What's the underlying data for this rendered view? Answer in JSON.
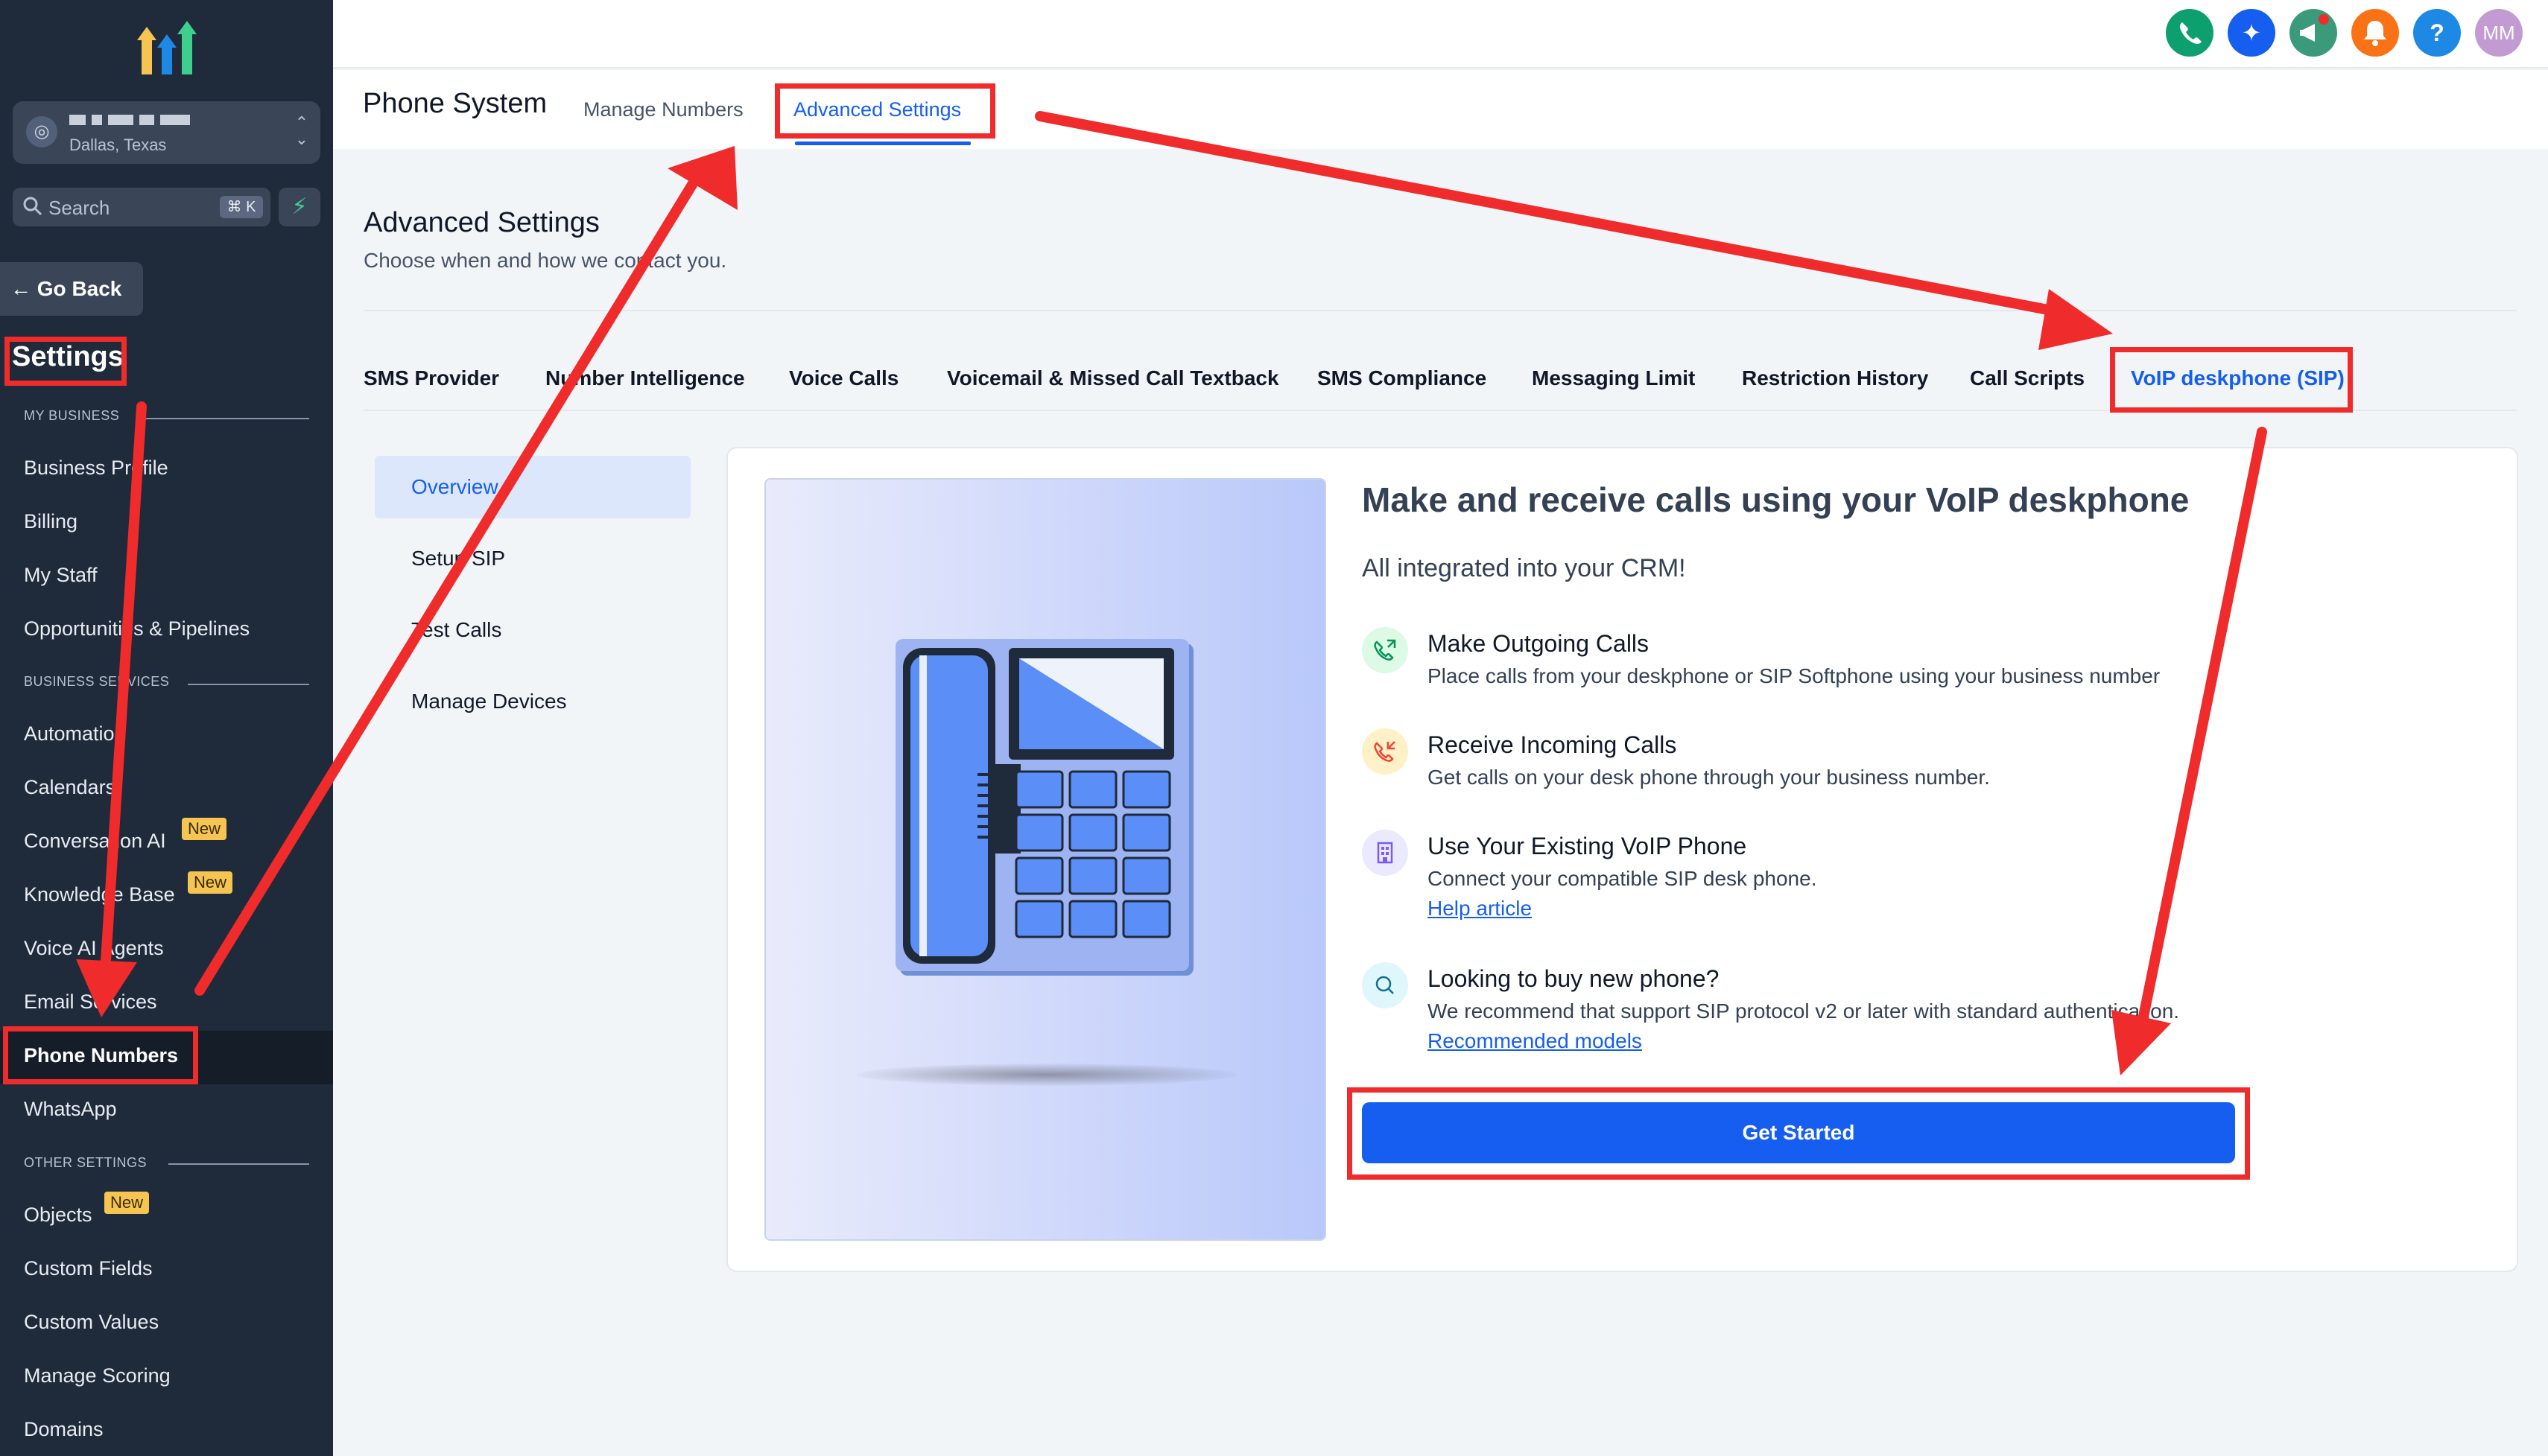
{
  "sidebar": {
    "account_location": "Dallas, Texas",
    "search_placeholder": "Search",
    "search_shortcut": "⌘ K",
    "go_back": "Go Back",
    "settings_title": "Settings",
    "sections": {
      "my_business": "MY BUSINESS",
      "business_services": "BUSINESS SERVICES",
      "other_settings": "OTHER SETTINGS"
    },
    "items": [
      {
        "label": "Business Profile"
      },
      {
        "label": "Billing"
      },
      {
        "label": "My Staff"
      },
      {
        "label": "Opportunities & Pipelines"
      },
      {
        "label": "Automation"
      },
      {
        "label": "Calendars"
      },
      {
        "label": "Conversation AI",
        "badge": "New"
      },
      {
        "label": "Knowledge Base",
        "badge": "New"
      },
      {
        "label": "Voice AI Agents"
      },
      {
        "label": "Email Services"
      },
      {
        "label": "Phone Numbers"
      },
      {
        "label": "WhatsApp"
      },
      {
        "label": "Objects",
        "badge": "New"
      },
      {
        "label": "Custom Fields"
      },
      {
        "label": "Custom Values"
      },
      {
        "label": "Manage Scoring"
      },
      {
        "label": "Domains"
      }
    ]
  },
  "topbar": {
    "help_label": "?",
    "avatar_initials": "MM",
    "icon_colors": {
      "phone": "#0e9f6e",
      "magic": "#155eef",
      "announce": "#3a9a7a",
      "bell": "#f97316",
      "help": "#1e88e5",
      "avatar": "#c39bd3"
    }
  },
  "header": {
    "title": "Phone System",
    "tabs": [
      "Manage Numbers",
      "Advanced Settings"
    ]
  },
  "content": {
    "heading": "Advanced Settings",
    "subheading": "Choose when and how we contact you.",
    "tabs": [
      "SMS Provider",
      "Number Intelligence",
      "Voice Calls",
      "Voicemail & Missed Call Textback",
      "SMS Compliance",
      "Messaging Limit",
      "Restriction History",
      "Call Scripts",
      "VoIP deskphone (SIP)"
    ],
    "subnav": [
      "Overview",
      "Setup SIP",
      "Test Calls",
      "Manage Devices"
    ]
  },
  "card": {
    "title": "Make and receive calls using your VoIP deskphone",
    "subtitle": "All integrated into your CRM!",
    "features": [
      {
        "icon": "phone-outgoing-icon",
        "title": "Make Outgoing Calls",
        "desc": "Place calls from your deskphone or SIP Softphone using your business number"
      },
      {
        "icon": "phone-incoming-icon",
        "title": "Receive Incoming Calls",
        "desc": "Get calls on your desk phone through your business number."
      },
      {
        "icon": "building-icon",
        "title": "Use Your Existing VoIP Phone",
        "desc": "Connect your compatible SIP desk phone.",
        "link": "Help article"
      },
      {
        "icon": "search-icon",
        "title": "Looking to buy new phone?",
        "desc": "We recommend that support SIP protocol v2 or later with standard authentication.",
        "link": "Recommended models"
      }
    ],
    "cta": "Get Started"
  },
  "colors": {
    "accent": "#155eef",
    "annotation": "#ef2b2b",
    "sidebar": "#1f2a3a"
  }
}
